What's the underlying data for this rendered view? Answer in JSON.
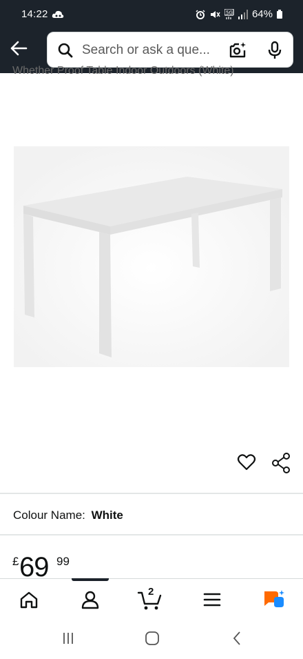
{
  "status_bar": {
    "time": "14:22",
    "battery": "64%"
  },
  "header": {
    "search_placeholder": "Search or ask a que...",
    "back_icon": "arrow-left-icon",
    "camera_icon": "camera-sparkle-icon",
    "mic_icon": "microphone-icon"
  },
  "product": {
    "title_fragment": "Whether Proof Table Indoor Outdoors (White)",
    "image_description": "white rectangular table",
    "colour_label": "Colour Name:",
    "colour_value": "White",
    "price": {
      "currency": "£",
      "whole": "69",
      "fraction": "99"
    }
  },
  "bottom_nav": {
    "items": [
      "home-icon",
      "account-icon",
      "cart-icon",
      "menu-icon",
      "rufus-assistant-icon"
    ],
    "cart_count": "2",
    "active_index": 1
  },
  "colors": {
    "header_bg": "#1c232b",
    "assistant_orange": "#ff6a00",
    "assistant_blue": "#1a8cff"
  }
}
